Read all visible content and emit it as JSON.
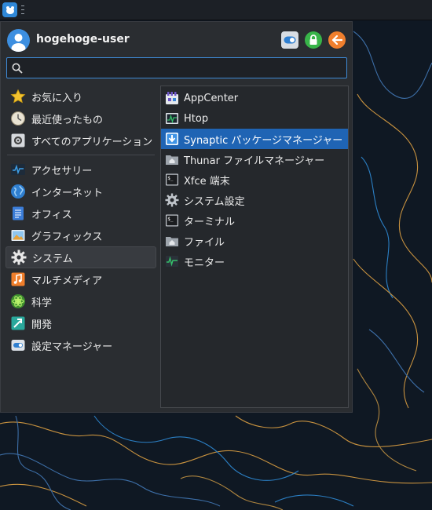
{
  "user": {
    "name": "hogehoge-user"
  },
  "search": {
    "value": "",
    "placeholder": ""
  },
  "categories": [
    {
      "label": "お気に入り",
      "icon": "star-icon"
    },
    {
      "label": "最近使ったもの",
      "icon": "clock-icon"
    },
    {
      "label": "すべてのアプリケーション",
      "icon": "all-apps-icon"
    },
    {
      "label": "アクセサリー",
      "icon": "accessories-icon"
    },
    {
      "label": "インターネット",
      "icon": "globe-icon"
    },
    {
      "label": "オフィス",
      "icon": "office-icon"
    },
    {
      "label": "グラフィックス",
      "icon": "graphics-icon"
    },
    {
      "label": "システム",
      "icon": "gear-icon",
      "active": true
    },
    {
      "label": "マルチメディア",
      "icon": "music-icon"
    },
    {
      "label": "科学",
      "icon": "science-icon"
    },
    {
      "label": "開発",
      "icon": "development-icon"
    },
    {
      "label": "設定マネージャー",
      "icon": "settings-toggle-icon"
    }
  ],
  "apps": [
    {
      "label": "AppCenter",
      "icon": "appcenter-icon"
    },
    {
      "label": "Htop",
      "icon": "htop-icon"
    },
    {
      "label": "Synaptic パッケージマネージャー",
      "icon": "synaptic-icon",
      "selected": true
    },
    {
      "label": "Thunar ファイルマネージャー",
      "icon": "folder-home-icon"
    },
    {
      "label": "Xfce 端末",
      "icon": "terminal-icon"
    },
    {
      "label": "システム設定",
      "icon": "system-settings-icon"
    },
    {
      "label": "ターミナル",
      "icon": "terminal-icon"
    },
    {
      "label": "ファイル",
      "icon": "folder-home-icon"
    },
    {
      "label": "モニター",
      "icon": "monitor-icon"
    }
  ],
  "colors": {
    "accent": "#1f64b4",
    "lock": "#38b449",
    "logout": "#f07f2d",
    "wallpaper": "#0f1823"
  }
}
